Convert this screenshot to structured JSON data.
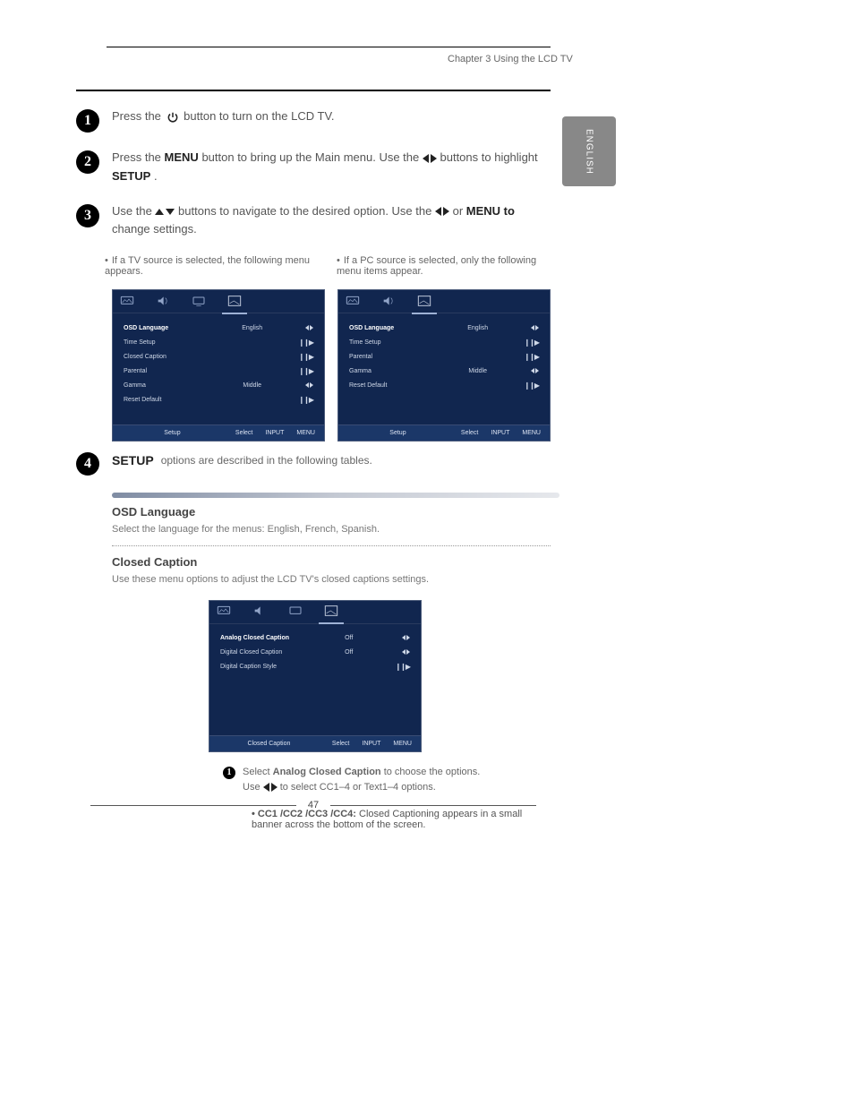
{
  "header": {
    "chapter": "Chapter 3 Using the LCD TV"
  },
  "langTab": "ENGLISH",
  "steps": {
    "s1": {
      "num": "1",
      "pre": "Press the ",
      "post": " button to turn on the LCD TV."
    },
    "s2": {
      "num": "2",
      "pre": "Press the ",
      "menu": "MENU",
      "mid": " button to bring up the Main menu. Use the ",
      "post2": " buttons to highlight ",
      "setup": "SETUP",
      "end": "."
    },
    "s3": {
      "num": "3",
      "pre": "Use the ",
      "mid": " buttons to navigate to the desired option. Use the ",
      "or": " or ",
      "menuTo": "MENU to",
      "end": " change settings."
    },
    "s4": {
      "num": "4"
    }
  },
  "colA": "If a TV source is selected, the following menu appears.",
  "colB": "If a PC source is selected, only the following menu items appear.",
  "osd": {
    "items": [
      {
        "label": "OSD Language",
        "value": "English",
        "glyph": "lr"
      },
      {
        "label": "Time Setup",
        "value": "",
        "glyph": "enter"
      },
      {
        "label": "Closed Caption",
        "value": "",
        "glyph": "enter"
      },
      {
        "label": "Parental",
        "value": "",
        "glyph": "enter"
      },
      {
        "label": "Gamma",
        "value": "Middle",
        "glyph": "lr"
      },
      {
        "label": "Reset Default",
        "value": "",
        "glyph": "enter"
      }
    ],
    "footTitle": "Setup",
    "footSelect": "Select",
    "footInput": "INPUT",
    "footMenu": "MENU"
  },
  "osdPC": {
    "items": [
      {
        "label": "OSD Language",
        "value": "English",
        "glyph": "lr"
      },
      {
        "label": "Time Setup",
        "value": "",
        "glyph": "enter"
      },
      {
        "label": "Parental",
        "value": "",
        "glyph": "enter"
      },
      {
        "label": "Gamma",
        "value": "Middle",
        "glyph": "lr"
      },
      {
        "label": "Reset Default",
        "value": "",
        "glyph": "enter"
      }
    ]
  },
  "setupLabel": "SETUP",
  "setupOptions": "options are described in the following tables.",
  "osdLang": {
    "title": "OSD Language",
    "desc": "Select the language for the menus: English, French, Spanish."
  },
  "closedCaption": {
    "title": "Closed Caption",
    "desc": "Use these menu options to adjust the LCD TV's closed captions settings."
  },
  "ccOSD": {
    "items": [
      {
        "label": "Analog Closed Caption",
        "value": "Off",
        "glyph": "lr"
      },
      {
        "label": "Digital Closed Caption",
        "value": "Off",
        "glyph": "lr"
      },
      {
        "label": "Digital Caption Style",
        "value": "",
        "glyph": "enter"
      }
    ],
    "footTitle": "Closed Caption"
  },
  "ccStep": {
    "num": "1",
    "pre": "Select ",
    "bold": "Analog Closed Caption",
    "post": " to choose the options. Use ",
    "post2": " to select CC1–4 or Text1–4 options."
  },
  "ccBullets": {
    "b1p": "CC1 /CC2 /CC3 /CC4:",
    "b1t": " Closed Captioning appears in a small banner across the bottom of the screen."
  },
  "pageNum": "47"
}
